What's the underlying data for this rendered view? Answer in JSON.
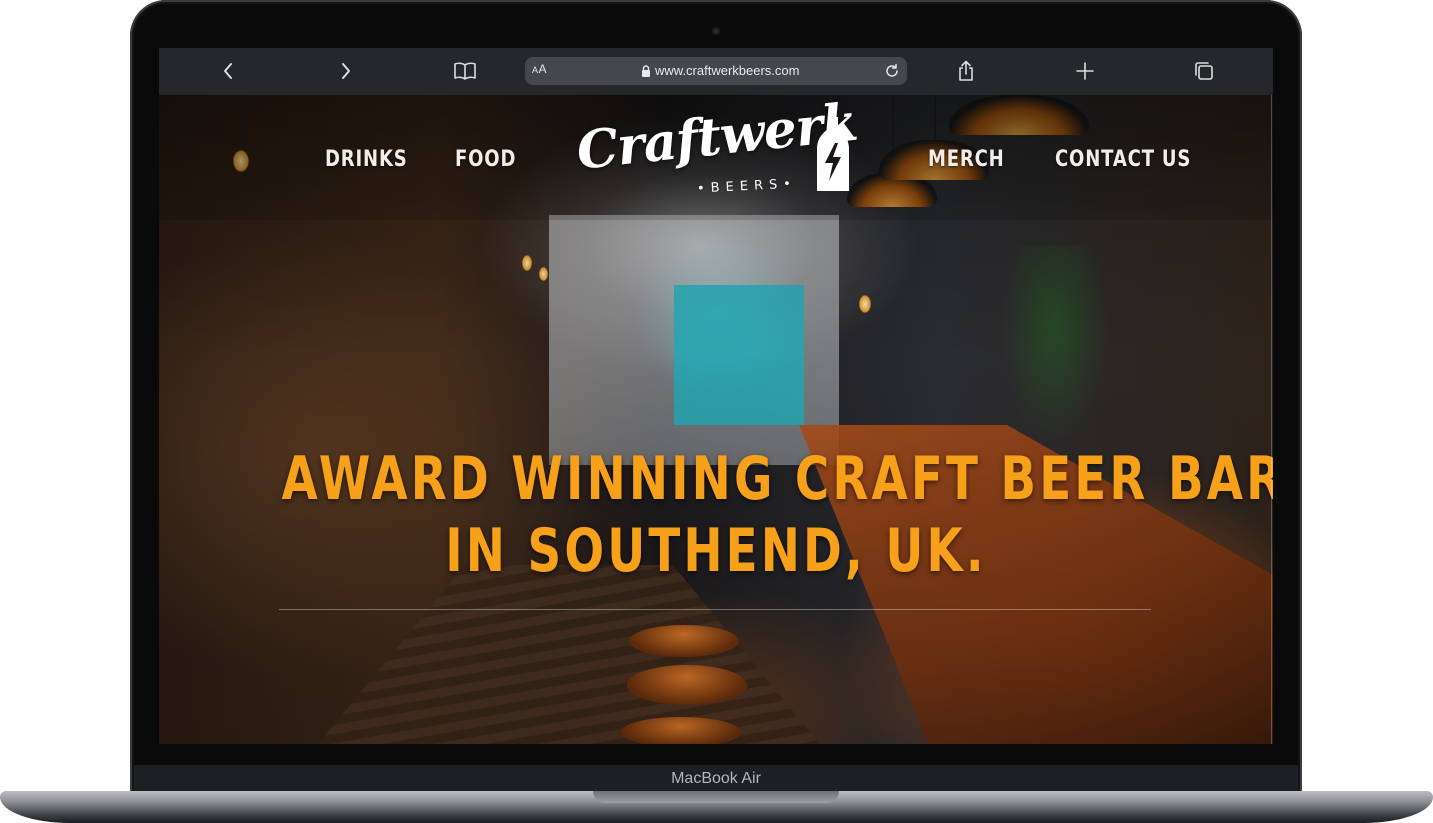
{
  "device": {
    "label": "MacBook Air"
  },
  "browser": {
    "url": "www.craftwerkbeers.com",
    "text_size_button": "AA",
    "icons": {
      "back": "chevron-left-icon",
      "forward": "chevron-right-icon",
      "bookmarks": "book-icon",
      "lock": "lock-icon",
      "reload": "reload-icon",
      "share": "share-icon",
      "new_tab": "plus-icon",
      "tabs": "tabs-icon"
    }
  },
  "site": {
    "nav": {
      "left": [
        "DRINKS",
        "FOOD"
      ],
      "right": [
        "MERCH",
        "CONTACT US"
      ]
    },
    "logo": {
      "name": "Craftwerk",
      "tagline": "•BEERS•"
    },
    "headline": {
      "line1": "AWARD WINNING CRAFT BEER BAR",
      "line2": "IN SOUTHEND, UK."
    },
    "colors": {
      "accent": "#f7a01a",
      "nav_text": "#f1eeea"
    }
  }
}
